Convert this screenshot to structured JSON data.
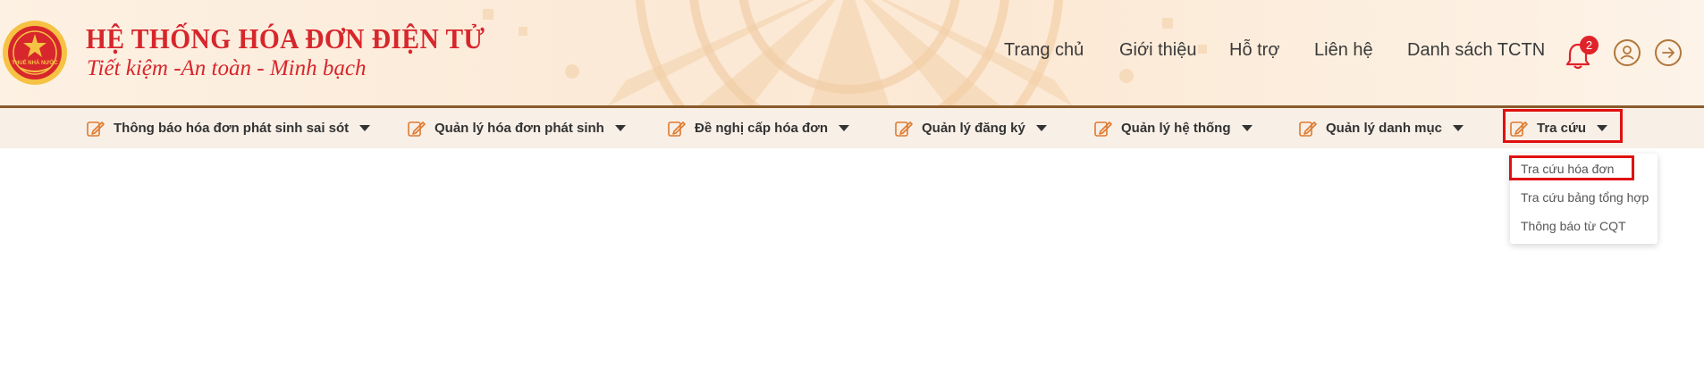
{
  "brand": {
    "title": "HỆ THỐNG HÓA ĐƠN ĐIỆN TỬ",
    "slogan": "Tiết kiệm -An toàn - Minh bạch",
    "logo_icon": "tax-emblem-logo"
  },
  "topnav": {
    "items": [
      "Trang chủ",
      "Giới thiệu",
      "Hỗ trợ",
      "Liên hệ",
      "Danh sách TCTN"
    ],
    "notification_count": "2",
    "notification_icon": "bell-icon",
    "user_icon": "user-icon",
    "logout_icon": "arrow-right-icon"
  },
  "menubar": {
    "items": [
      {
        "label": "Thông báo hóa đơn phát sinh sai sót",
        "icon": "edit-document-icon"
      },
      {
        "label": "Quản lý hóa đơn phát sinh",
        "icon": "edit-document-icon"
      },
      {
        "label": "Đề nghị cấp hóa đơn",
        "icon": "edit-document-icon"
      },
      {
        "label": "Quản lý đăng ký",
        "icon": "edit-document-icon"
      },
      {
        "label": "Quản lý hệ thống",
        "icon": "edit-document-icon"
      },
      {
        "label": "Quản lý danh mục",
        "icon": "edit-document-icon"
      },
      {
        "label": "Tra cứu",
        "icon": "edit-document-icon"
      }
    ]
  },
  "dropdown": {
    "items": [
      "Tra cứu hóa đơn",
      "Tra cứu bảng tổng hợp",
      "Thông báo từ CQT"
    ]
  },
  "colors": {
    "brand_red": "#d7262c",
    "highlight_red": "#e01010",
    "header_line": "#8a5b2b",
    "menubar_bg": "#f8efe7",
    "icon_orange": "#e07a2e"
  }
}
